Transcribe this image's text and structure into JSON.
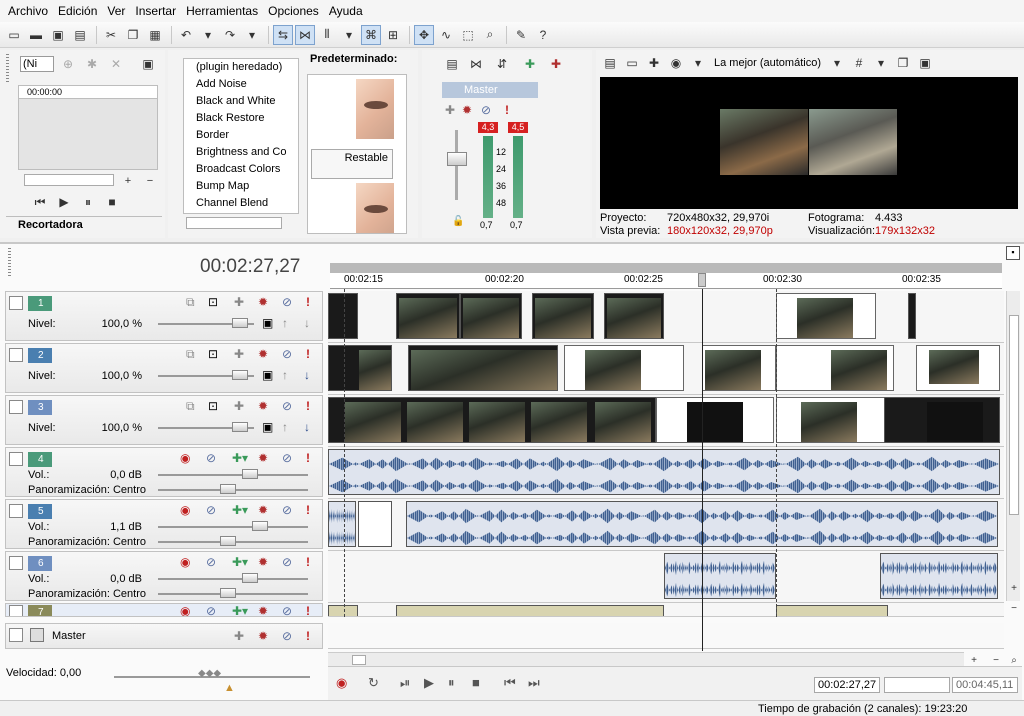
{
  "menu": [
    "Archivo",
    "Edición",
    "Ver",
    "Insertar",
    "Herramientas",
    "Opciones",
    "Ayuda"
  ],
  "trimmer": {
    "select_value": "(Ni",
    "timecode": "00:00:00",
    "tab_label": "Recortadora"
  },
  "fx": {
    "items": [
      "(plugin heredado)",
      "Add Noise",
      "Black and White",
      "Black Restore",
      "Border",
      "Brightness and Co",
      "Broadcast Colors",
      "Bump Map",
      "Channel Blend"
    ],
    "presets_title": "Predeterminado:",
    "preset_label": "Restable"
  },
  "master_bus": {
    "title": "Master",
    "left_peak": "4,3",
    "right_peak": "4,5",
    "scale": [
      "12",
      "24",
      "36",
      "48"
    ],
    "left_value": "0,7",
    "right_value": "0,7"
  },
  "preview": {
    "quality": "La mejor (automático)",
    "project_label": "Proyecto:",
    "project_value": "720x480x32, 29,970i",
    "preview_label": "Vista previa:",
    "preview_value": "180x120x32, 29,970p",
    "frame_label": "Fotograma:",
    "frame_value": "4.433",
    "display_label": "Visualización:",
    "display_value": "179x132x32"
  },
  "timeline": {
    "timecode": "00:02:27,27",
    "ruler": [
      "00:02:15",
      "00:02:20",
      "00:02:25",
      "00:02:30",
      "00:02:35"
    ]
  },
  "tracks": [
    {
      "num": "1",
      "type": "video",
      "label": "Nivel:",
      "value": "100,0 %",
      "color": "#4a9a7a"
    },
    {
      "num": "2",
      "type": "video",
      "label": "Nivel:",
      "value": "100,0 %",
      "color": "#4a7fb0"
    },
    {
      "num": "3",
      "type": "video",
      "label": "Nivel:",
      "value": "100,0 %",
      "color": "#6f8fc0"
    },
    {
      "num": "4",
      "type": "audio",
      "label": "Vol.:",
      "value": "0,0 dB",
      "pan": "Panoramización: Centro",
      "color": "#4a9a7a"
    },
    {
      "num": "5",
      "type": "audio",
      "label": "Vol.:",
      "value": "1,1 dB",
      "pan": "Panoramización: Centro",
      "color": "#4a7fb0"
    },
    {
      "num": "6",
      "type": "audio",
      "label": "Vol.:",
      "value": "0,0 dB",
      "pan": "Panoramización: Centro",
      "color": "#6f8fc0"
    },
    {
      "num": "7",
      "type": "audio",
      "color": "#8a8a5a"
    }
  ],
  "master_track": {
    "label": "Master"
  },
  "speed": "Velocidad: 0,00",
  "transport": {
    "position": "00:02:27,27",
    "end": "00:04:45,11"
  },
  "status": "Tiempo de grabación (2 canales): 19:23:20"
}
